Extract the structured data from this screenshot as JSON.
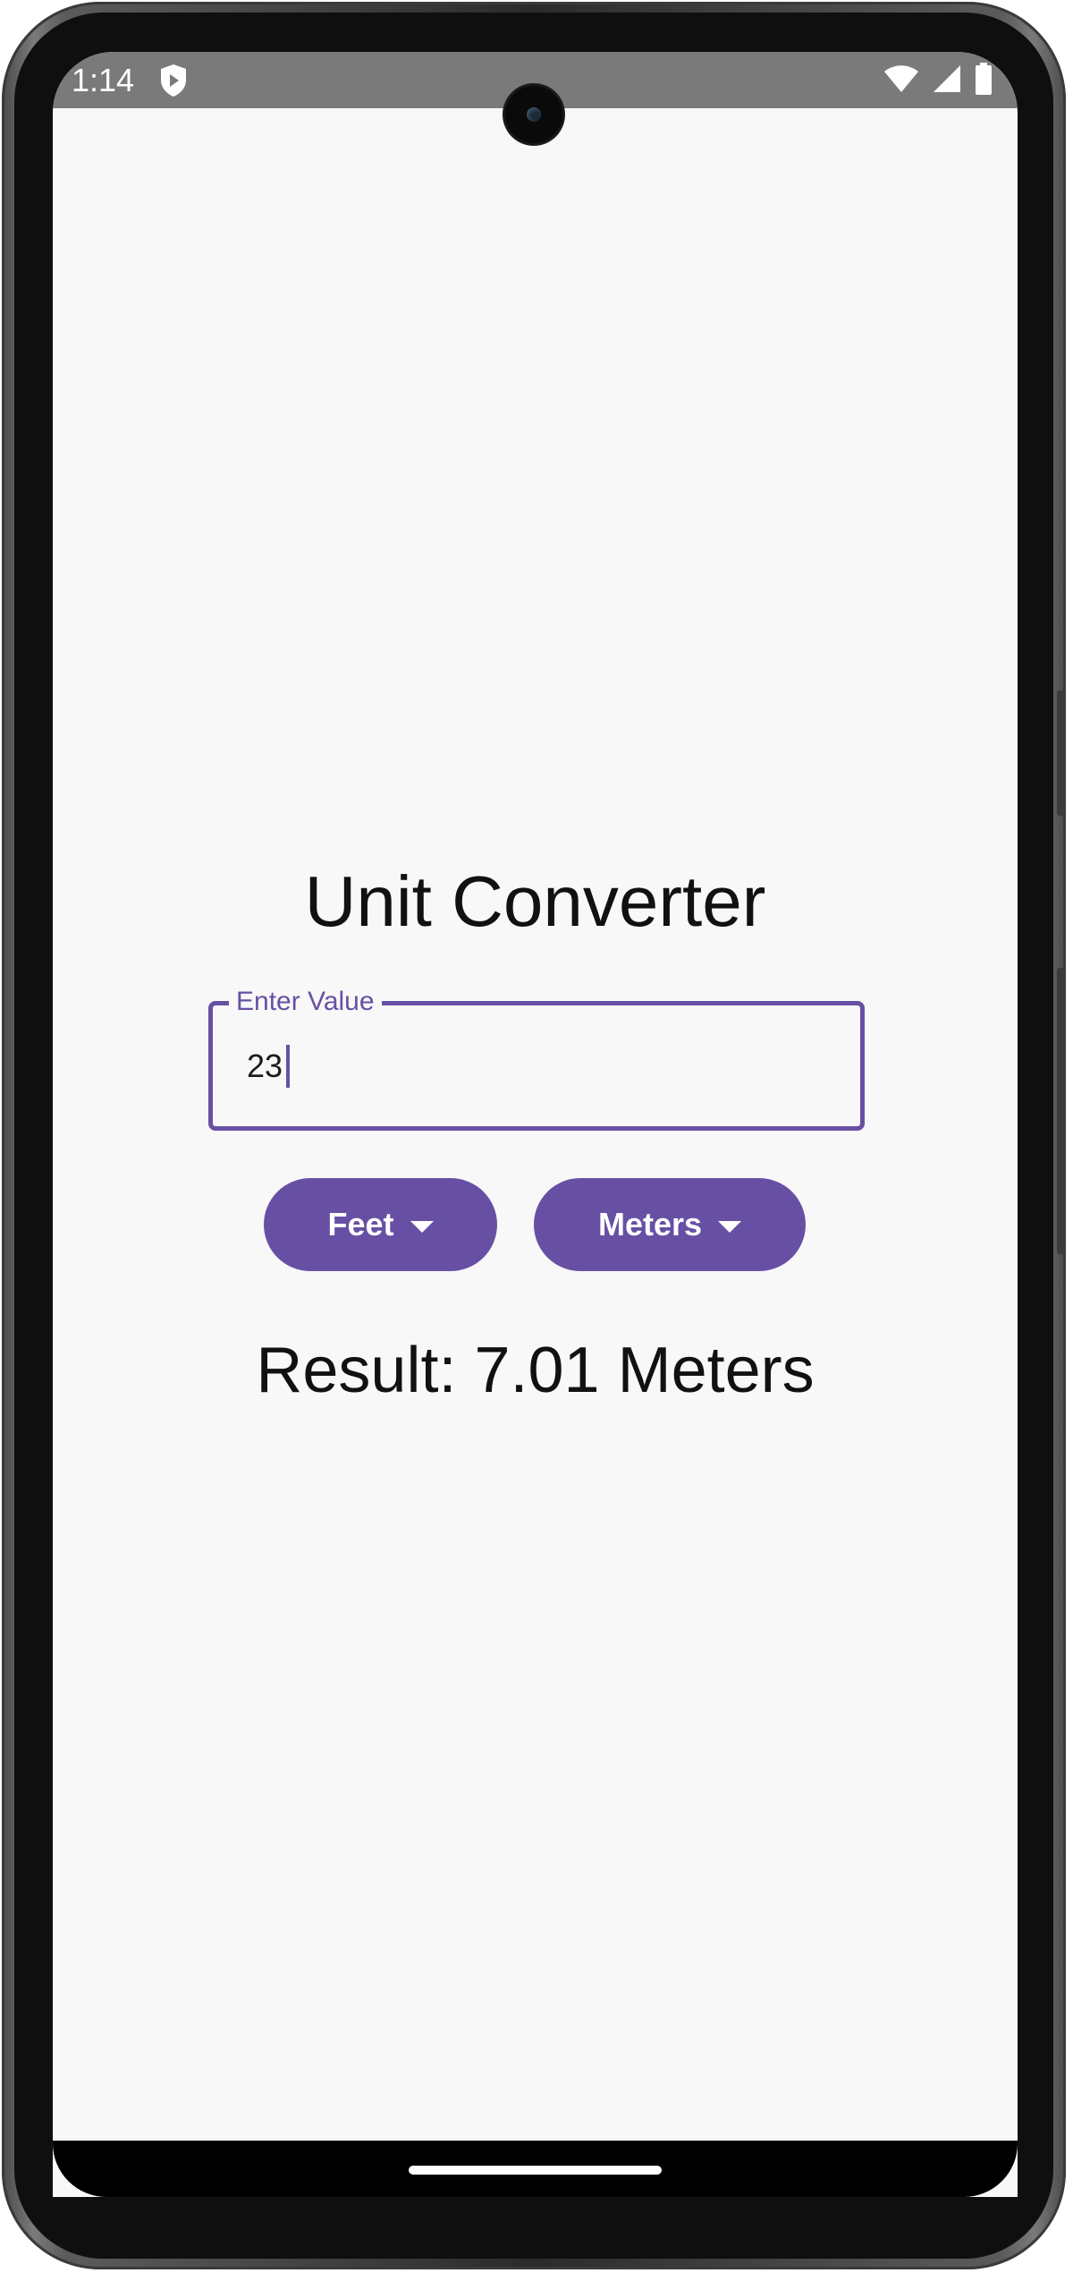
{
  "status_bar": {
    "time": "1:14",
    "left_icons": [
      "shield-play-icon"
    ],
    "right_icons": [
      "wifi-icon",
      "cellular-signal-icon",
      "battery-icon"
    ]
  },
  "app": {
    "title": "Unit Converter",
    "input": {
      "label": "Enter Value",
      "value": "23",
      "focused": true
    },
    "from_unit": {
      "label": "Feet",
      "icon": "arrow-drop-down-icon"
    },
    "to_unit": {
      "label": "Meters",
      "icon": "arrow-drop-down-icon"
    },
    "result": "Result: 7.01 Meters"
  },
  "colors": {
    "accent": "#6750a4",
    "background": "#f8f8f8",
    "status_bar": "#7a7a7a",
    "text": "#111111"
  }
}
